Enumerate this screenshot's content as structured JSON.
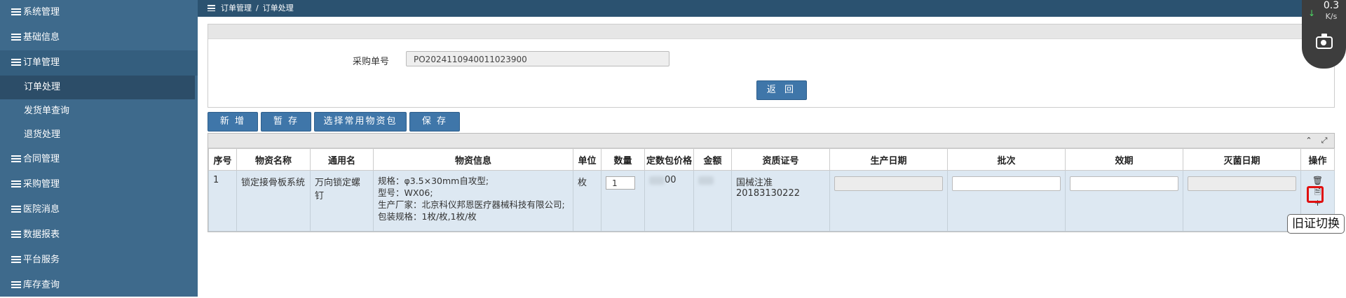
{
  "sidebar": {
    "items": [
      {
        "label": "系统管理"
      },
      {
        "label": "基础信息"
      },
      {
        "label": "订单管理"
      },
      {
        "label": "合同管理"
      },
      {
        "label": "采购管理"
      },
      {
        "label": "医院消息"
      },
      {
        "label": "数据报表"
      },
      {
        "label": "平台服务"
      },
      {
        "label": "库存查询"
      }
    ],
    "sub_items": [
      {
        "label": "订单处理"
      },
      {
        "label": "发货单查询"
      },
      {
        "label": "退货处理"
      }
    ]
  },
  "breadcrumb": {
    "parent": "订单管理",
    "separator": "/",
    "current": "订单处理"
  },
  "form": {
    "po_label": "采购单号",
    "po_value": "PO2024110940011023900",
    "back_label": "返 回"
  },
  "toolbar": {
    "add": "新 增",
    "draft": "暂 存",
    "choose_pkg": "选择常用物资包",
    "save": "保 存"
  },
  "table": {
    "headers": [
      "序号",
      "物资名称",
      "通用名",
      "物资信息",
      "单位",
      "数量",
      "定数包价格",
      "金额",
      "资质证号",
      "生产日期",
      "批次",
      "效期",
      "灭菌日期",
      "操作"
    ],
    "row": {
      "index": "1",
      "name": "锁定接骨板系统",
      "generic": "万向锁定螺钉",
      "info": [
        "规格：φ3.5×30mm自攻型;",
        "型号：WX06;",
        "生产厂家：北京科仪邦恩医疗器械科技有限公司;",
        "包装规格：1枚/枚,1枚/枚"
      ],
      "unit": "枚",
      "qty": "1",
      "price_suffix": "00",
      "cert": "国械注准20183130222"
    }
  },
  "tooltip": {
    "text": "旧证切换"
  },
  "widget": {
    "speed_value": "0.3",
    "speed_unit": "K/s"
  }
}
